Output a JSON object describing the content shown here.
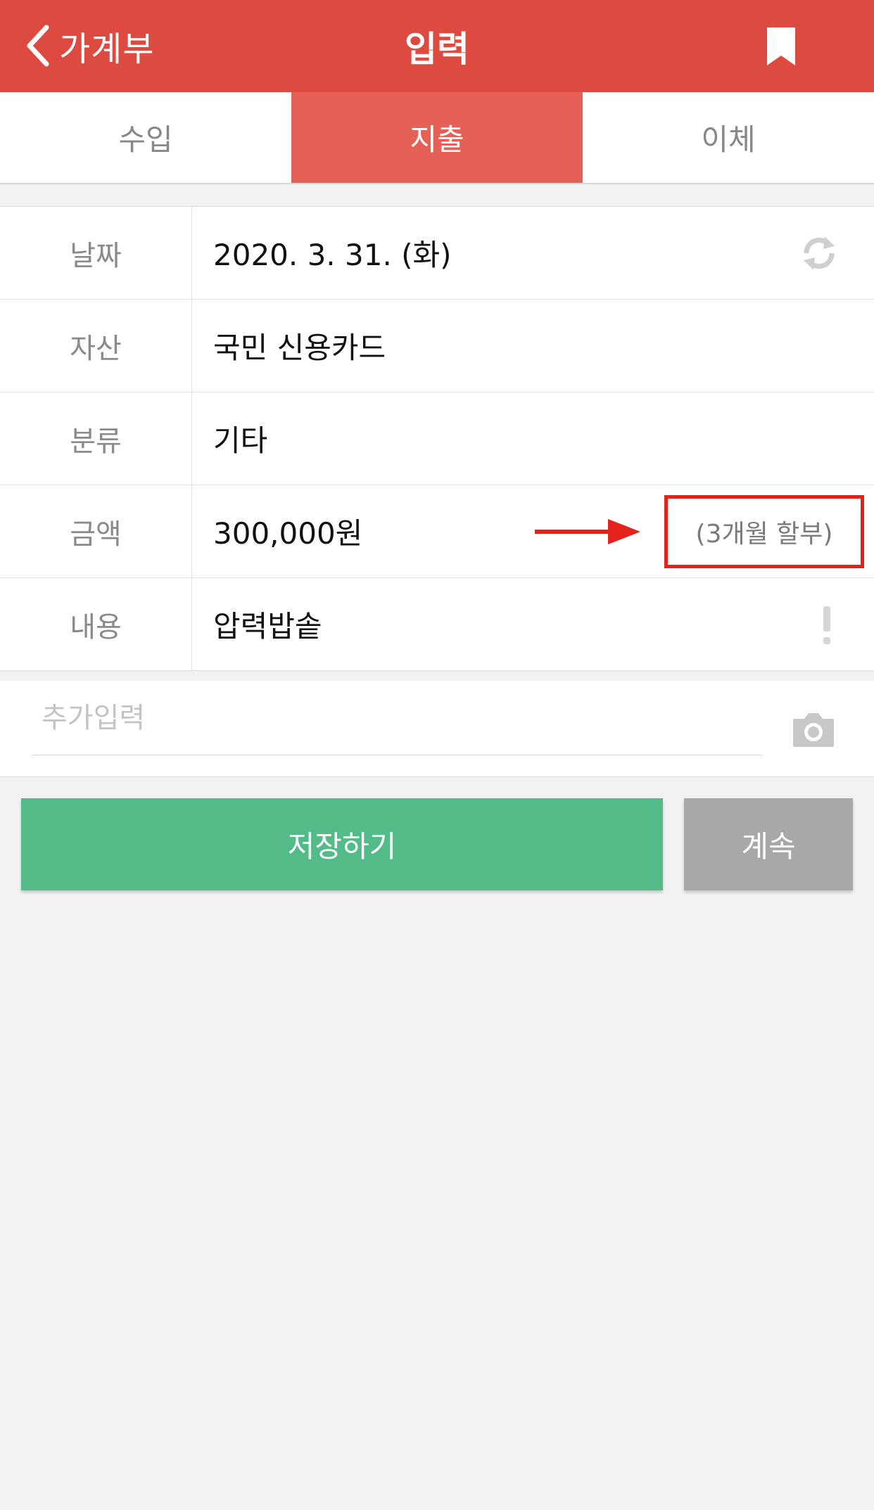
{
  "header": {
    "back_label": "가계부",
    "title": "입력",
    "bg_color": "#dc4a40"
  },
  "tabs": [
    {
      "label": "수입",
      "active": false
    },
    {
      "label": "지출",
      "active": true
    },
    {
      "label": "이체",
      "active": false
    }
  ],
  "form": {
    "date": {
      "label": "날짜",
      "value": "2020. 3. 31. (화)"
    },
    "asset": {
      "label": "자산",
      "value": "국민 신용카드"
    },
    "category": {
      "label": "분류",
      "value": "기타"
    },
    "amount": {
      "label": "금액",
      "value": "300,000원",
      "installment": "(3개월 할부)"
    },
    "content": {
      "label": "내용",
      "value": "압력밥솥"
    }
  },
  "memo": {
    "placeholder": "추가입력",
    "value": ""
  },
  "buttons": {
    "save_label": "저장하기",
    "continue_label": "계속",
    "save_color": "#52bb88",
    "continue_color": "#a8a8a8"
  },
  "annotation_color": "#e3231b",
  "icons": [
    "chevron-left-icon",
    "bookmark-icon",
    "refresh-icon",
    "arrow-right-icon",
    "exclamation-icon",
    "camera-icon"
  ]
}
